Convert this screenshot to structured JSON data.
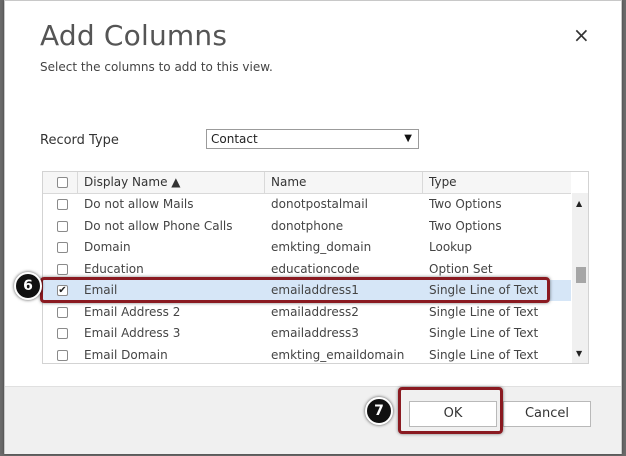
{
  "dialog": {
    "title": "Add Columns",
    "subtitle": "Select the columns to add to this view.",
    "close_icon": "×"
  },
  "record_type": {
    "label": "Record Type",
    "value": "Contact",
    "arrow": "▼"
  },
  "grid": {
    "headers": {
      "display_name": "Display Name ▲",
      "name": "Name",
      "type": "Type"
    },
    "rows": [
      {
        "display": "Do not allow Mails",
        "name": "donotpostalmail",
        "type": "Two Options",
        "checked": false
      },
      {
        "display": "Do not allow Phone Calls",
        "name": "donotphone",
        "type": "Two Options",
        "checked": false
      },
      {
        "display": "Domain",
        "name": "emkting_domain",
        "type": "Lookup",
        "checked": false
      },
      {
        "display": "Education",
        "name": "educationcode",
        "type": "Option Set",
        "checked": false
      },
      {
        "display": "Email",
        "name": "emailaddress1",
        "type": "Single Line of Text",
        "checked": true
      },
      {
        "display": "Email Address 2",
        "name": "emailaddress2",
        "type": "Single Line of Text",
        "checked": false
      },
      {
        "display": "Email Address 3",
        "name": "emailaddress3",
        "type": "Single Line of Text",
        "checked": false
      },
      {
        "display": "Email Domain",
        "name": "emkting_emaildomain",
        "type": "Single Line of Text",
        "checked": false
      }
    ],
    "selected_row": 4,
    "check_glyph": "✔",
    "scroll_up": "▲",
    "scroll_down": "▼"
  },
  "buttons": {
    "ok": "OK",
    "cancel": "Cancel"
  },
  "callouts": {
    "step6": "6",
    "step7": "7"
  },
  "colors": {
    "highlight": "#8a1a21",
    "selected_row": "#d6e6f7"
  }
}
